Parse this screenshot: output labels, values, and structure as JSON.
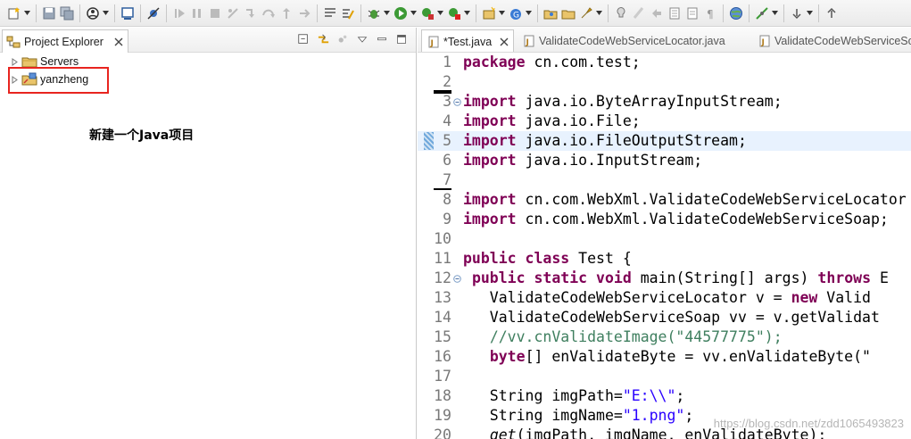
{
  "toolbar": {
    "icons": [
      "new-icon",
      "save-icon",
      "save-all-icon",
      "skip-icon",
      "console-icon",
      "skip-breakpoints-icon",
      "resume-icon",
      "suspend-icon",
      "terminate-icon",
      "disconnect-icon",
      "step-into-icon",
      "step-over-icon",
      "step-return-icon",
      "drop-frame-icon",
      "use-step-filters-icon",
      "build-icon",
      "debug-icon",
      "run-icon",
      "coverage-icon",
      "external-tools-icon",
      "new-project-icon",
      "new-class-icon",
      "open-type-icon",
      "open-folder-icon",
      "search-icon",
      "annotation-icon",
      "toggle-mark-icon",
      "show-whitespace-icon",
      "block-select-icon",
      "pilcrow-icon",
      "globe-icon",
      "team-icon",
      "next-annotation-icon"
    ]
  },
  "explorer": {
    "tab_label": "Project Explorer",
    "items": [
      {
        "label": "Servers",
        "icon": "folder-icon"
      },
      {
        "label": "yanzheng",
        "icon": "project-icon"
      }
    ],
    "annotation": "新建一个Java项目",
    "highlight_color": "#e8241f"
  },
  "editor": {
    "tabs": [
      {
        "label": "*Test.java",
        "active": true
      },
      {
        "label": "ValidateCodeWebServiceLocator.java",
        "active": false
      },
      {
        "label": "ValidateCodeWebServiceSo",
        "active": false
      }
    ],
    "lines": [
      {
        "n": "1",
        "segs": [
          [
            "kw",
            "package"
          ],
          [
            "",
            " cn.com.test;"
          ]
        ]
      },
      {
        "n": "2",
        "segs": []
      },
      {
        "n": "3",
        "segs": [
          [
            "kw",
            "import"
          ],
          [
            "",
            " java.io.ByteArrayInputStream;"
          ]
        ],
        "fold": true
      },
      {
        "n": "4",
        "segs": [
          [
            "kw",
            "import"
          ],
          [
            "",
            " java.io.File;"
          ]
        ]
      },
      {
        "n": "5",
        "segs": [
          [
            "kw",
            "import"
          ],
          [
            "",
            " java.io.FileOutputStream;"
          ]
        ],
        "current": true
      },
      {
        "n": "6",
        "segs": [
          [
            "kw",
            "import"
          ],
          [
            "",
            " java.io.InputStream;"
          ]
        ]
      },
      {
        "n": "7",
        "segs": []
      },
      {
        "n": "8",
        "segs": [
          [
            "kw",
            "import"
          ],
          [
            "",
            " cn.com.WebXml.ValidateCodeWebServiceLocator"
          ]
        ]
      },
      {
        "n": "9",
        "segs": [
          [
            "kw",
            "import"
          ],
          [
            "",
            " cn.com.WebXml.ValidateCodeWebServiceSoap;"
          ]
        ]
      },
      {
        "n": "10",
        "segs": []
      },
      {
        "n": "11",
        "segs": [
          [
            "kw",
            "public"
          ],
          [
            "",
            " "
          ],
          [
            "kw",
            "class"
          ],
          [
            "",
            " Test {"
          ]
        ]
      },
      {
        "n": "12",
        "segs": [
          [
            "",
            " "
          ],
          [
            "kw",
            "public"
          ],
          [
            "",
            " "
          ],
          [
            "kw",
            "static"
          ],
          [
            "",
            " "
          ],
          [
            "kw",
            "void"
          ],
          [
            "",
            " main(String[] args) "
          ],
          [
            "kw",
            "throws"
          ],
          [
            "",
            " E"
          ]
        ],
        "fold": true
      },
      {
        "n": "13",
        "segs": [
          [
            "",
            "   ValidateCodeWebServiceLocator v = "
          ],
          [
            "kw",
            "new"
          ],
          [
            "",
            " Valid"
          ]
        ]
      },
      {
        "n": "14",
        "segs": [
          [
            "",
            "   ValidateCodeWebServiceSoap vv = v.getValidat"
          ]
        ]
      },
      {
        "n": "15",
        "segs": [
          [
            "",
            "   "
          ],
          [
            "cmt",
            "//vv.cnValidateImage(\"44577775\");"
          ]
        ]
      },
      {
        "n": "16",
        "segs": [
          [
            "",
            "   "
          ],
          [
            "kw",
            "byte"
          ],
          [
            "",
            "[] enValidateByte = vv.enValidateByte(\""
          ]
        ]
      },
      {
        "n": "17",
        "segs": []
      },
      {
        "n": "18",
        "segs": [
          [
            "",
            "   String imgPath="
          ],
          [
            "str",
            "\"E:\\\\\""
          ],
          [
            ";"
          ]
        ]
      },
      {
        "n": "19",
        "segs": [
          [
            "",
            "   String imgName="
          ],
          [
            "str",
            "\"1.png\""
          ],
          [
            ";"
          ]
        ]
      },
      {
        "n": "20",
        "segs": [
          [
            "",
            "   "
          ],
          [
            "it",
            "get"
          ],
          [
            "",
            "(imgPath, imgName, enValidateByte);"
          ]
        ]
      }
    ]
  },
  "watermark": "https://blog.csdn.net/zdd1065493823"
}
